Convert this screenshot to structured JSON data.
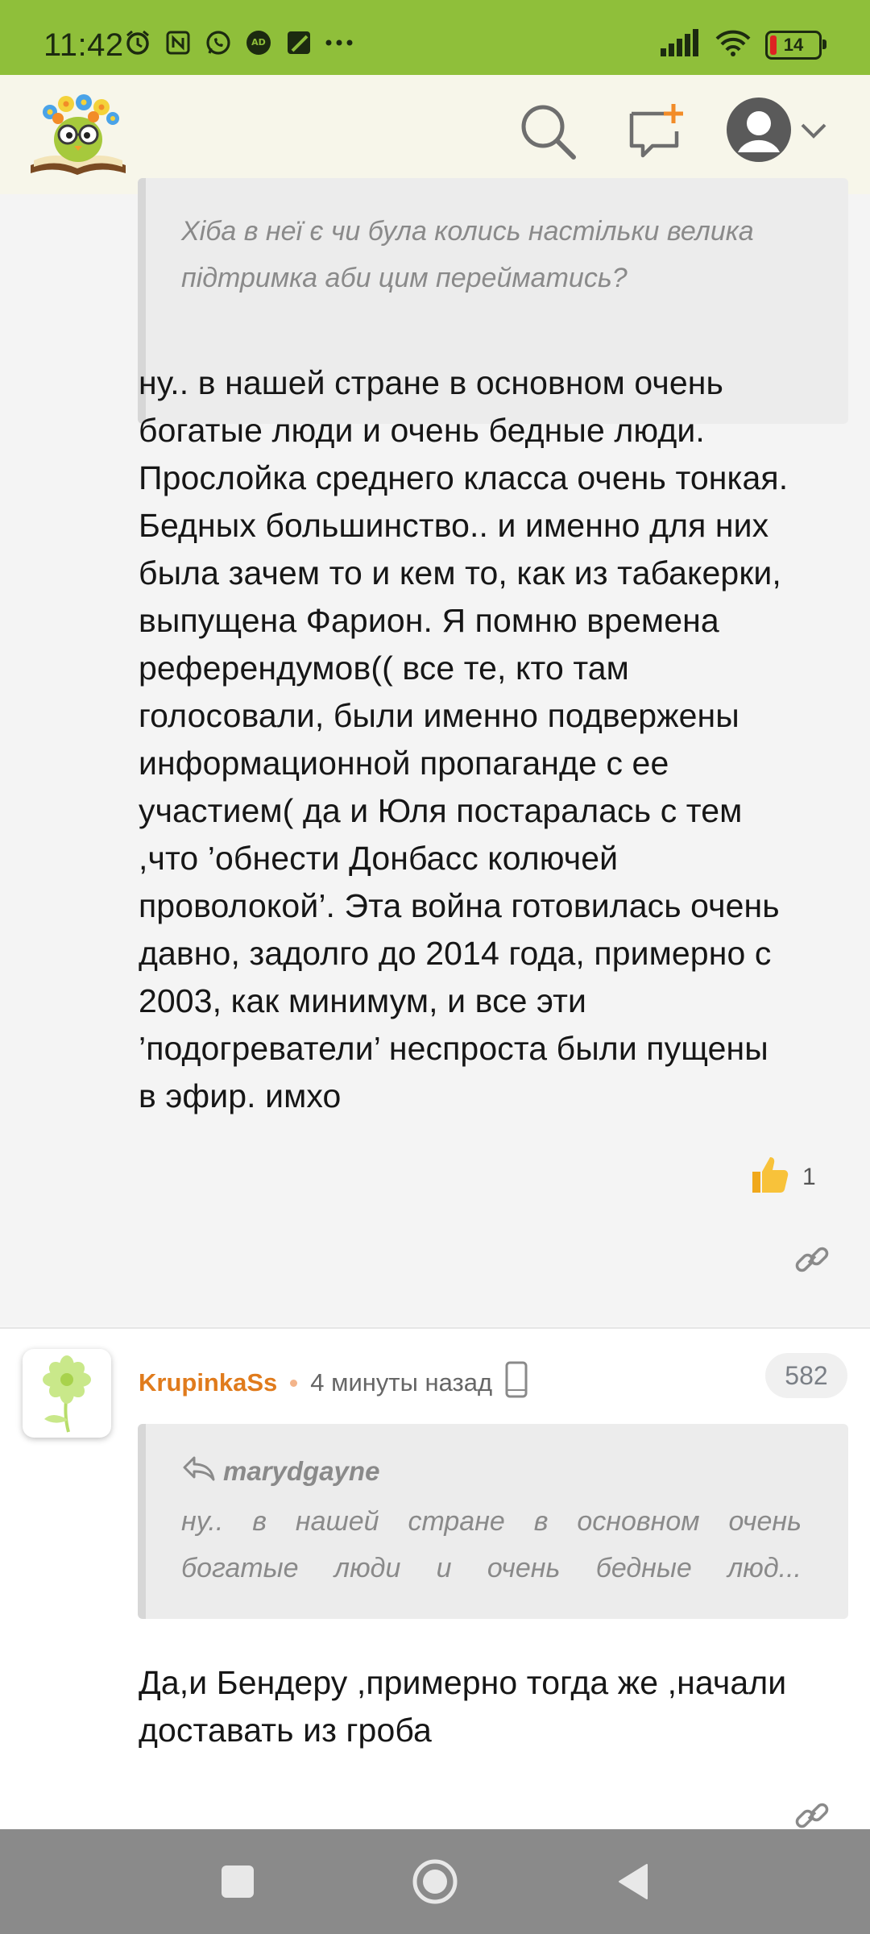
{
  "status_bar": {
    "time": "11:42",
    "icons": [
      "alarm-icon",
      "nfc-icon",
      "whatsapp-icon",
      "adblock-icon",
      "app-icon",
      "more-icon"
    ],
    "battery_level": "14",
    "battery_color": "#dd2222"
  },
  "header": {
    "logo": "book-owl-logo",
    "actions": [
      "search-icon",
      "new-post-icon",
      "user-avatar",
      "chevron-down-icon"
    ],
    "accent_color": "#f28c28"
  },
  "comment1": {
    "quote_text_line1": "Хіба в неї є чи була колись настільки велика",
    "quote_text_line2": "підтримка аби цим перейматись?",
    "body_lines": [
      "ну.. в нашей стране в основном очень",
      "богатые люди и очень бедные люди.",
      "Прослойка среднего класса очень тонкая.",
      "Бедных большинство.. и именно для них",
      "была зачем то и кем то, как из табакерки,",
      "выпущена Фарион. Я помню времена",
      "референдумов(( все те, кто там",
      "голосовали, были именно подвержены",
      "информационной пропаганде с ее",
      "участием( да и Юля постаралась с тем",
      ",что ’обнести Донбасс колючей",
      "проволокой’. Эта война готовилась очень",
      "давно, задолго до 2014 года, примерно с",
      "2003, как минимум, и все эти",
      "’подогреватели’ неспроста были пущены",
      "в эфир. имхо"
    ],
    "likes": "1"
  },
  "comment2": {
    "username": "KrupinkaSs",
    "time": "4 минуты назад",
    "rating": "582",
    "quote_author": "marydgayne",
    "quote_line1": "ну.. в нашей стране в основном очень",
    "quote_line2": "богатые люди и очень бедные люд...",
    "body_lines": [
      "Да,и Бендеру ,примерно тогда же ,начали",
      "доставать из гроба"
    ]
  },
  "nav": {
    "buttons": [
      "recents-button",
      "home-button",
      "back-button"
    ]
  }
}
